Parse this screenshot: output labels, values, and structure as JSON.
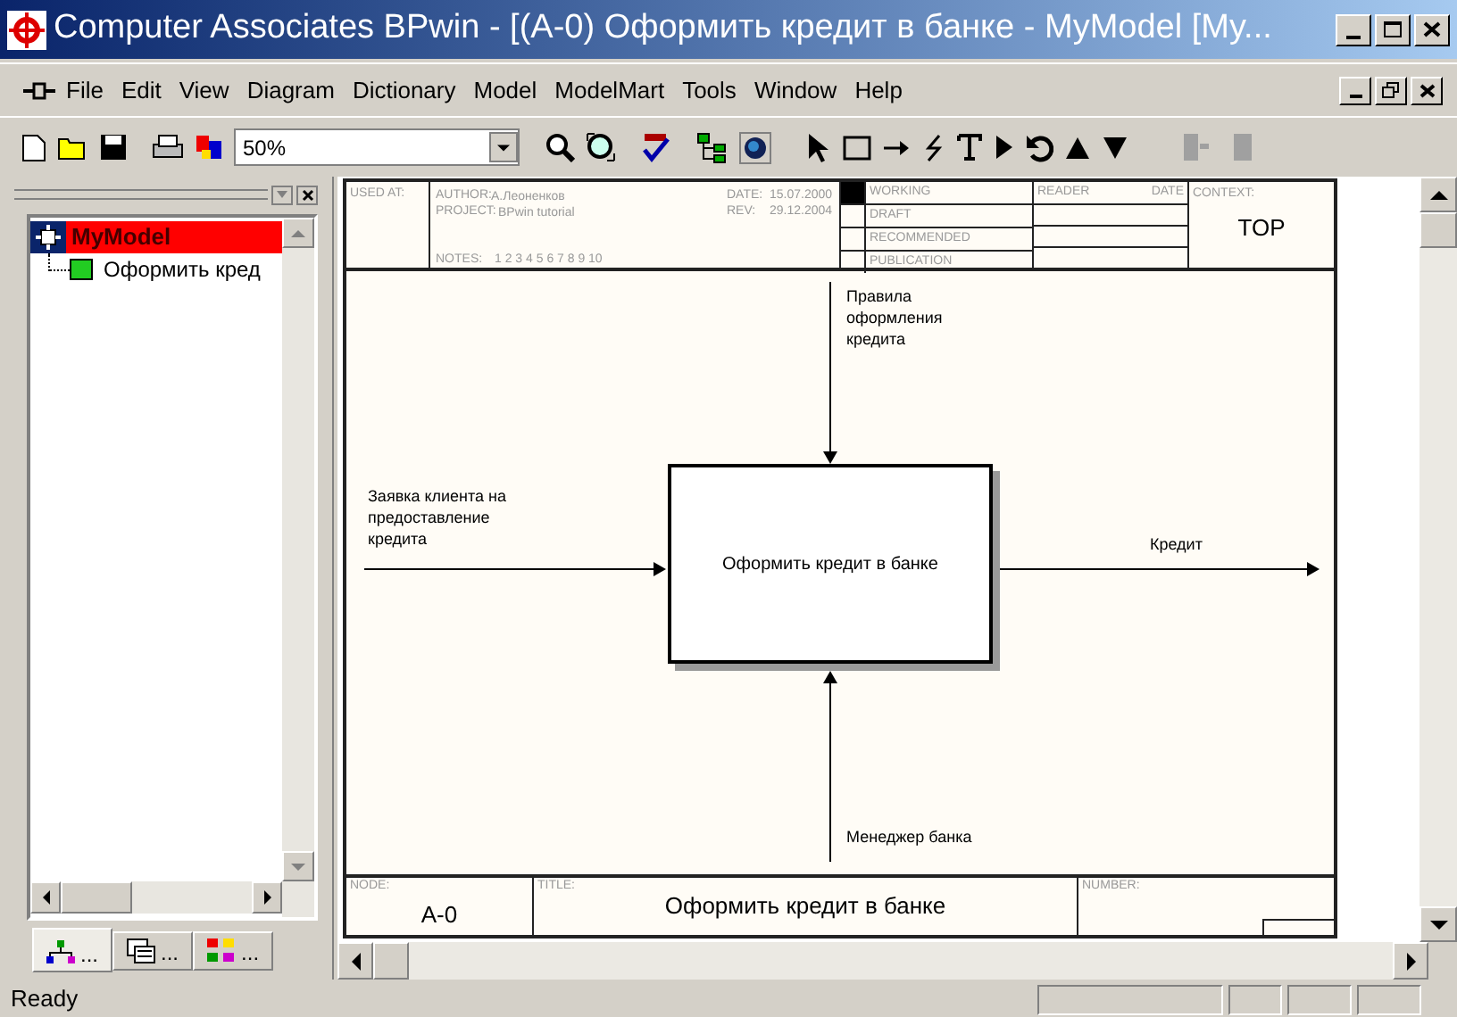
{
  "window": {
    "title": "Computer Associates BPwin - [(A-0) Оформить кредит в банке - MyModel  [My..."
  },
  "menu": [
    "File",
    "Edit",
    "View",
    "Diagram",
    "Dictionary",
    "Model",
    "ModelMart",
    "Tools",
    "Window",
    "Help"
  ],
  "toolbar": {
    "zoom": "50%"
  },
  "tree": {
    "label": "MyModel",
    "selected": true,
    "children": [
      {
        "label": "Оформить кред",
        "selected": false
      }
    ]
  },
  "panel_tabs": [
    {
      "label": "...",
      "selected": true
    },
    {
      "label": "...",
      "selected": false
    },
    {
      "label": "...",
      "selected": false
    }
  ],
  "diagram": {
    "header": {
      "used_at": "USED AT:",
      "author_label": "AUTHOR:",
      "author": "А.Леоненков",
      "project_label": "PROJECT:",
      "project": "BPwin tutorial",
      "date_label": "DATE:",
      "date": "15.07.2000",
      "rev_label": "REV:",
      "rev": "29.12.2004",
      "notes_label": "NOTES:",
      "notes": "1  2  3  4  5  6  7  8  9  10",
      "reader": "READER",
      "reader_date": "DATE",
      "context_label": "CONTEXT:",
      "context": "TOP"
    },
    "statuses": [
      {
        "label": "WORKING",
        "selected": true
      },
      {
        "label": "DRAFT",
        "selected": false
      },
      {
        "label": "RECOMMENDED",
        "selected": false
      },
      {
        "label": "PUBLICATION",
        "selected": false
      }
    ],
    "box": "Оформить кредит в банке",
    "arrows": [
      {
        "kind": "control",
        "label": "Правила\nоформления\nкредита"
      },
      {
        "kind": "input",
        "label": "Заявка клиента на\nпредоставление\nкредита"
      },
      {
        "kind": "output",
        "label": "Кредит"
      },
      {
        "kind": "mechanism",
        "label": "Менеджер банка"
      }
    ],
    "footer": {
      "node_label": "NODE:",
      "node": "A-0",
      "title_label": "TITLE:",
      "title": "Оформить кредит в банке",
      "number_label": "NUMBER:"
    }
  },
  "status_bar": "Ready"
}
